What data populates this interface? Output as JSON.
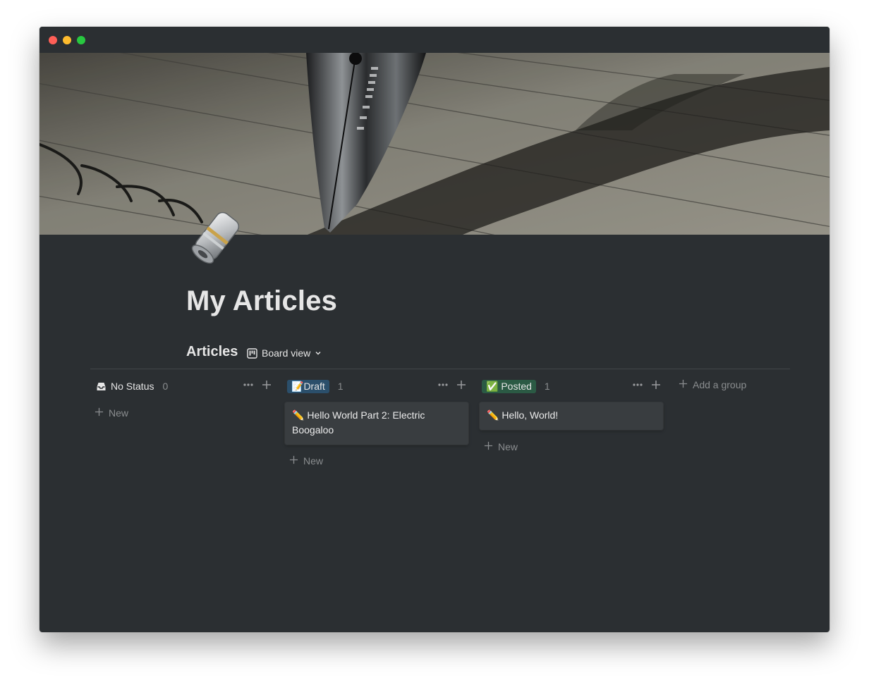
{
  "page": {
    "title": "My Articles",
    "cover_icon": "fountain-pen-cover-image",
    "page_icon": "scroll-icon"
  },
  "database": {
    "title": "Articles",
    "view_label": "Board view",
    "add_group_label": "Add a group",
    "new_label": "New",
    "groups": [
      {
        "label": "No Status",
        "count": "0",
        "icon": "inbox-icon",
        "cards": []
      },
      {
        "label": "Draft",
        "emoji": "📝",
        "count": "1",
        "color": "#2b4f6b",
        "cards": [
          {
            "emoji": "✏️",
            "title": "Hello World Part 2: Electric Boogaloo"
          }
        ]
      },
      {
        "label": "Posted",
        "emoji": "✅",
        "count": "1",
        "color": "#2b5a44",
        "cards": [
          {
            "emoji": "✏️",
            "title": "Hello, World!"
          }
        ]
      }
    ]
  },
  "colors": {
    "background": "#2b2f32",
    "card": "#393d40",
    "text": "#e6e6e6",
    "muted": "#8a8d8f"
  }
}
